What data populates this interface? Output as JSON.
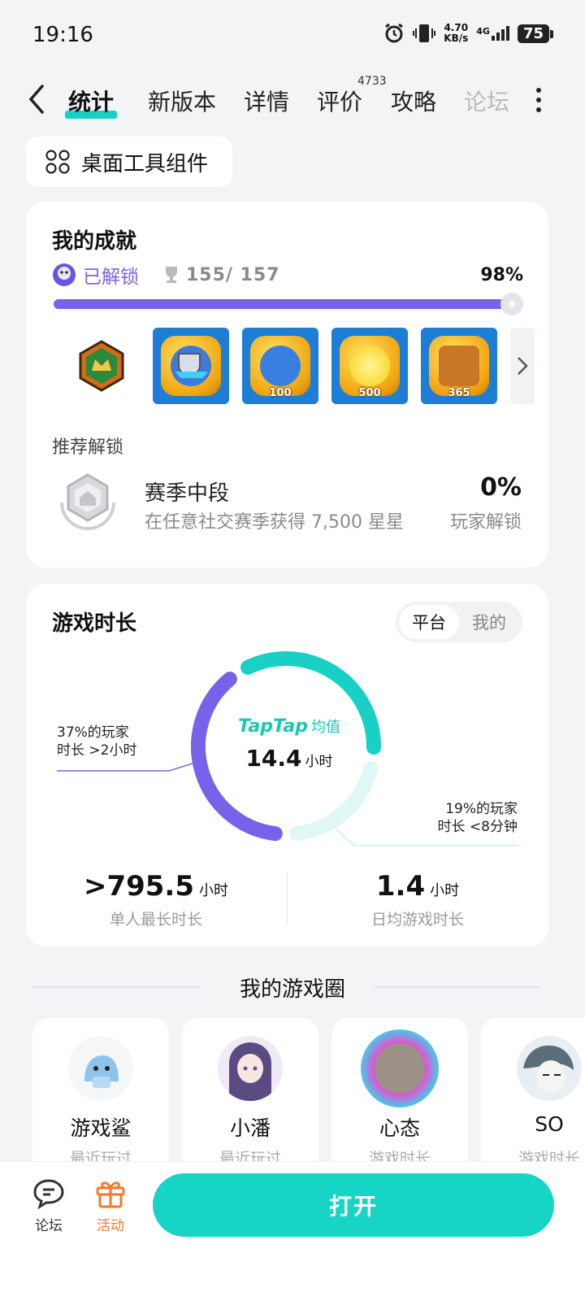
{
  "status_bar": {
    "time": "19:16",
    "net_speed": "4.70",
    "net_unit": "KB/s",
    "network": "4G",
    "battery": "75"
  },
  "nav": {
    "tabs": [
      {
        "label": "统计"
      },
      {
        "label": "新版本"
      },
      {
        "label": "详情"
      },
      {
        "label": "评价",
        "badge": "4733"
      },
      {
        "label": "攻略"
      },
      {
        "label": "论坛"
      }
    ]
  },
  "widget_button": {
    "label": "桌面工具组件"
  },
  "achievements": {
    "title": "我的成就",
    "unlocked_label": "已解锁",
    "count": "155/ 157",
    "percent": "98%",
    "progress": 0.98,
    "badges": [
      {
        "num": ""
      },
      {
        "num": "100"
      },
      {
        "num": "500"
      },
      {
        "num": "365"
      }
    ],
    "recommend_label": "推荐解锁",
    "recommend": {
      "name": "赛季中段",
      "desc": "在任意社交赛季获得 7,500 星星",
      "percent": "0%",
      "sub": "玩家解锁"
    }
  },
  "playtime": {
    "title": "游戏时长",
    "toggle": [
      "平台",
      "我的"
    ],
    "brand": "TapTap",
    "avg_label": "均值",
    "avg_value": "14.4",
    "unit": "小时",
    "left_note_1": "37%的玩家",
    "left_note_2": "时长 >2小时",
    "right_note_1": "19%的玩家",
    "right_note_2": "时长 <8分钟",
    "segments": {
      "long_share": 0.37,
      "short_share": 0.19
    },
    "stats": [
      {
        "value": ">795.5",
        "unit": "小时",
        "label": "单人最长时长"
      },
      {
        "value": "1.4",
        "unit": "小时",
        "label": "日均游戏时长"
      }
    ],
    "colors": {
      "purple": "#7763ea",
      "teal": "#19d0c4",
      "light": "#dff7f5"
    }
  },
  "circle": {
    "title": "我的游戏圈",
    "friends": [
      {
        "name": "游戏鲨",
        "status": "最近玩过"
      },
      {
        "name": "小潘",
        "status": "最近玩过"
      },
      {
        "name": "心态",
        "status": "游戏时长"
      },
      {
        "name": "SO",
        "status": "游戏时长"
      }
    ]
  },
  "bottom": {
    "forum": "论坛",
    "activity": "活动",
    "open": "打开"
  }
}
